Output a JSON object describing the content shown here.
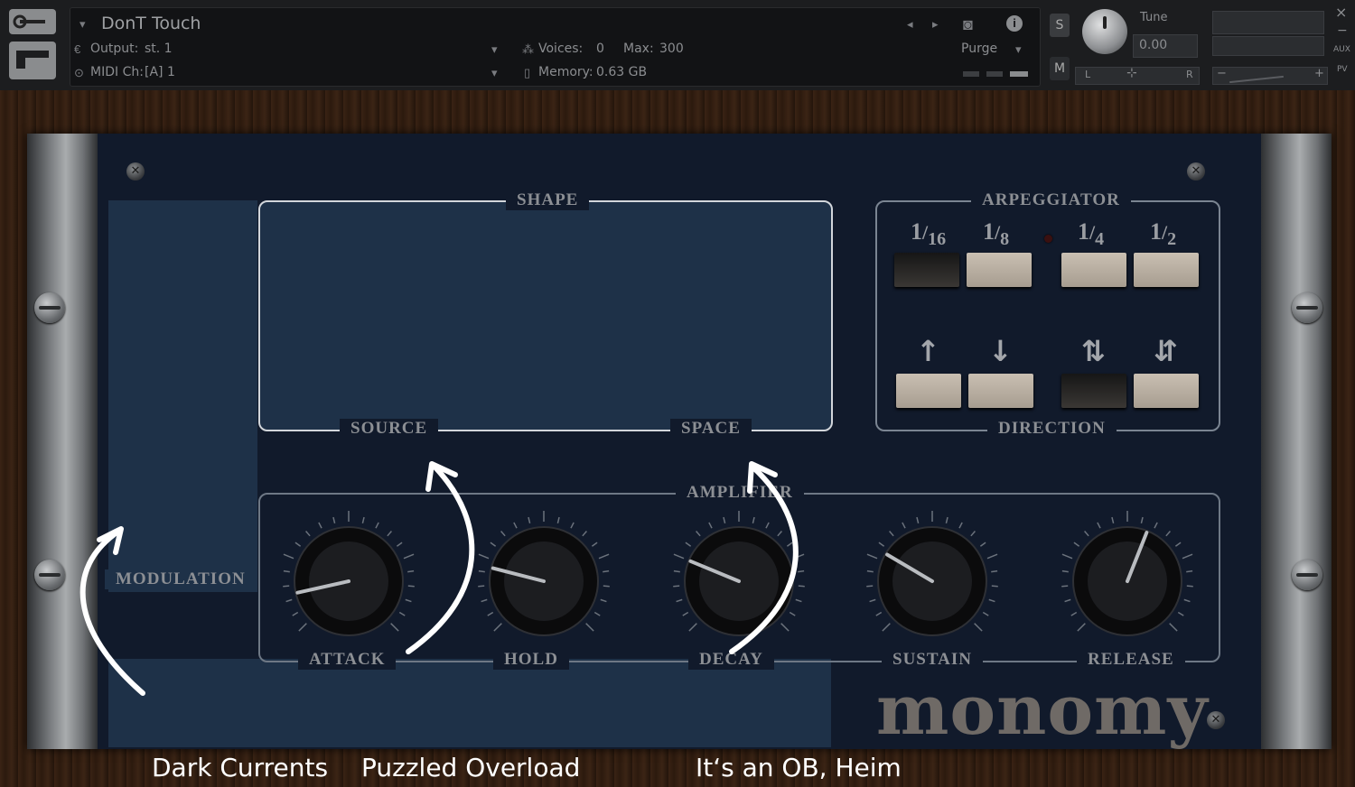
{
  "header": {
    "instrument_name": "DonT Touch",
    "output_label": "Output:",
    "output_value": "st. 1",
    "midi_label": "MIDI Ch:",
    "midi_value": "[A]  1",
    "voices_label": "Voices:",
    "voices_value": "0",
    "max_label": "Max:",
    "max_value": "300",
    "memory_label": "Memory:",
    "memory_value": "0.63 GB",
    "purge_label": "Purge",
    "solo_label": "S",
    "mute_label": "M",
    "tune_label": "Tune",
    "tune_value": "0.00",
    "pan_left": "L",
    "pan_right": "R",
    "aux_label": "AUX",
    "pv_label": "PV",
    "minus_label": "−",
    "plus_label": "+",
    "close_label": "×",
    "minimize_label": "−"
  },
  "panel": {
    "shape_label": "SHAPE",
    "source_label": "SOURCE",
    "space_label": "SPACE",
    "modulation_label": "MODULATION",
    "arpeggiator_label": "ARPEGGIATOR",
    "direction_label": "DIRECTION",
    "amplifier_label": "AMPLIFIER",
    "rates": [
      {
        "num": "1",
        "den": "16",
        "active": true
      },
      {
        "num": "1",
        "den": "8",
        "active": false
      },
      {
        "num": "1",
        "den": "4",
        "active": false
      },
      {
        "num": "1",
        "den": "2",
        "active": false
      }
    ],
    "directions": [
      {
        "symbol": "↑",
        "active": false
      },
      {
        "symbol": "↓",
        "active": false
      },
      {
        "symbol": "⇅",
        "active": true
      },
      {
        "symbol": "⇵",
        "active": false
      }
    ],
    "knobs": [
      {
        "label": "ATTACK",
        "value": 0.12
      },
      {
        "label": "HOLD",
        "value": 0.22
      },
      {
        "label": "DECAY",
        "value": 0.25
      },
      {
        "label": "SUSTAIN",
        "value": 0.28
      },
      {
        "label": "RELEASE",
        "value": 0.58
      }
    ],
    "logo": "monomy"
  },
  "captions": {
    "dark_currents": "Dark Currents",
    "puzzled_overload": "Puzzled Overload",
    "ob_heim": "It‘s an OB, Heim"
  },
  "colors": {
    "rack_background": "#111a2b",
    "panel_light": "#1e3148",
    "arp_key": "#b8ae a1",
    "caption_text": "#ffffff"
  }
}
